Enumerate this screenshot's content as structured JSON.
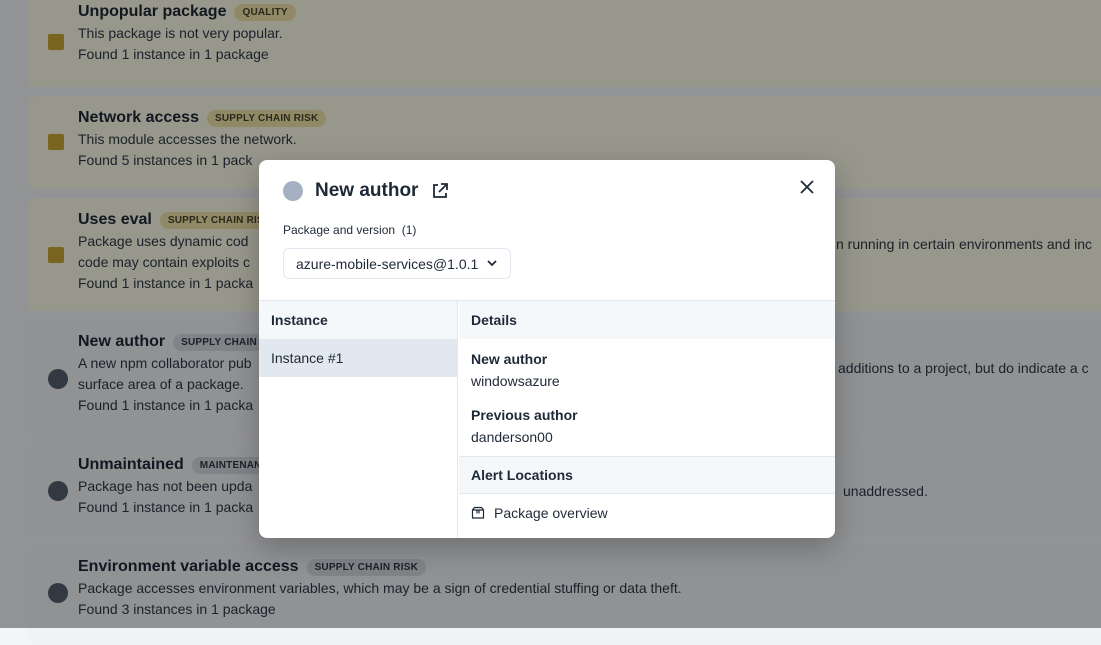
{
  "alerts": [
    {
      "title": "Unpopular package",
      "badge": "QUALITY",
      "lines": [
        "This package is not very popular.",
        "Found 1 instance in 1 package"
      ]
    },
    {
      "title": "Network access",
      "badge": "SUPPLY CHAIN RISK",
      "lines": [
        "This module accesses the network.",
        "Found 5 instances in 1 pack"
      ]
    },
    {
      "title": "Uses eval",
      "badge": "SUPPLY CHAIN RIS",
      "lines": [
        "Package uses dynamic cod",
        "code may contain exploits c",
        "Found 1 instance in 1 packa"
      ],
      "right": "n running in certain environments and inc"
    },
    {
      "title": "New author",
      "badge": "SUPPLY CHAIN",
      "lines": [
        "A new npm collaborator pub",
        "surface area of a package.",
        "Found 1 instance in 1 packa"
      ],
      "right": "additions to a project, but do indicate a c"
    },
    {
      "title": "Unmaintained",
      "badge": "MAINTENAN",
      "lines": [
        "Package has not been upda",
        "Found 1 instance in 1 packa"
      ],
      "right": "unaddressed."
    },
    {
      "title": "Environment variable access",
      "badge": "SUPPLY CHAIN RISK",
      "lines": [
        "Package accesses environment variables, which may be a sign of credential stuffing or data theft.",
        "Found 3 instances in 1 package"
      ]
    }
  ],
  "modal": {
    "title": "New author",
    "pkg_label": "Package and version",
    "pkg_count": "(1)",
    "pkg_value": "azure-mobile-services@1.0.1",
    "instance_header": "Instance",
    "instances": [
      "Instance #1"
    ],
    "details_header": "Details",
    "new_author_label": "New author",
    "new_author": "windowsazure",
    "prev_author_label": "Previous author",
    "prev_author": "danderson00",
    "locations_header": "Alert Locations",
    "location": "Package overview"
  },
  "colors": {
    "warn": "#c9a227",
    "info": "#4b5563",
    "accent": "#a5b1c2"
  }
}
